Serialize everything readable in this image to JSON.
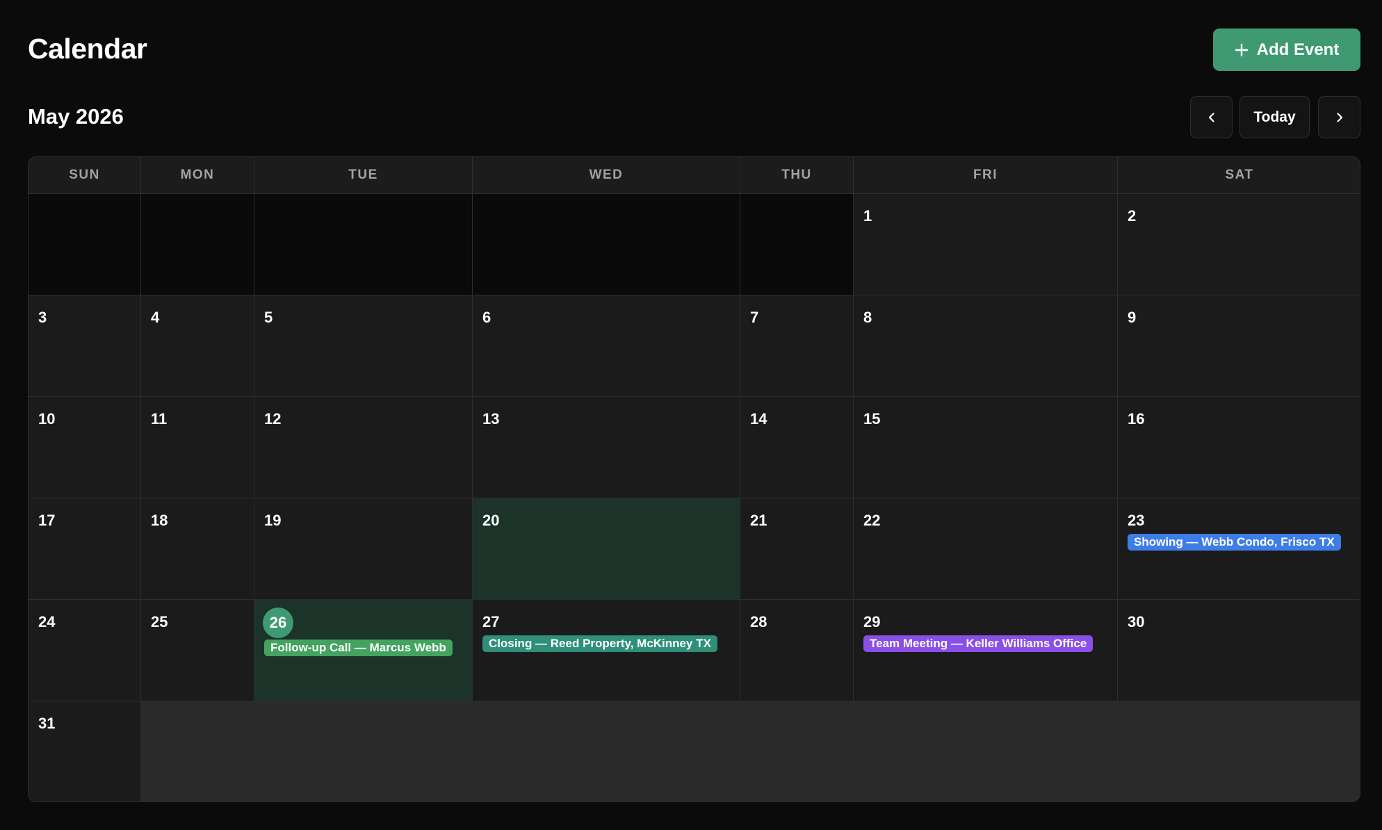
{
  "header": {
    "title": "Calendar",
    "add_event_label": "Add Event"
  },
  "toolbar": {
    "month_label": "May 2026",
    "today_label": "Today",
    "prev_icon": "chevron-left-icon",
    "next_icon": "chevron-right-icon"
  },
  "weekdays": [
    "SUN",
    "MON",
    "TUE",
    "WED",
    "THU",
    "FRI",
    "SAT"
  ],
  "colors": {
    "accent": "#3f9a72",
    "highlight_cell": "#1b3329",
    "event_blue": "#3f7de6",
    "event_green": "#43a35f",
    "event_teal": "#2f8f78",
    "event_purple": "#8a4fe6"
  },
  "today": 26,
  "highlighted_days": [
    20,
    26
  ],
  "days": {
    "d1": "1",
    "d2": "2",
    "d3": "3",
    "d4": "4",
    "d5": "5",
    "d6": "6",
    "d7": "7",
    "d8": "8",
    "d9": "9",
    "d10": "10",
    "d11": "11",
    "d12": "12",
    "d13": "13",
    "d14": "14",
    "d15": "15",
    "d16": "16",
    "d17": "17",
    "d18": "18",
    "d19": "19",
    "d20": "20",
    "d21": "21",
    "d22": "22",
    "d23": "23",
    "d24": "24",
    "d25": "25",
    "d26": "26",
    "d27": "27",
    "d28": "28",
    "d29": "29",
    "d30": "30",
    "d31": "31"
  },
  "events": {
    "e23": "Showing — Webb Condo, Frisco TX",
    "e26": "Follow-up Call — Marcus Webb",
    "e27": "Closing — Reed Property, McKinney TX",
    "e29": "Team Meeting — Keller Williams Office"
  }
}
